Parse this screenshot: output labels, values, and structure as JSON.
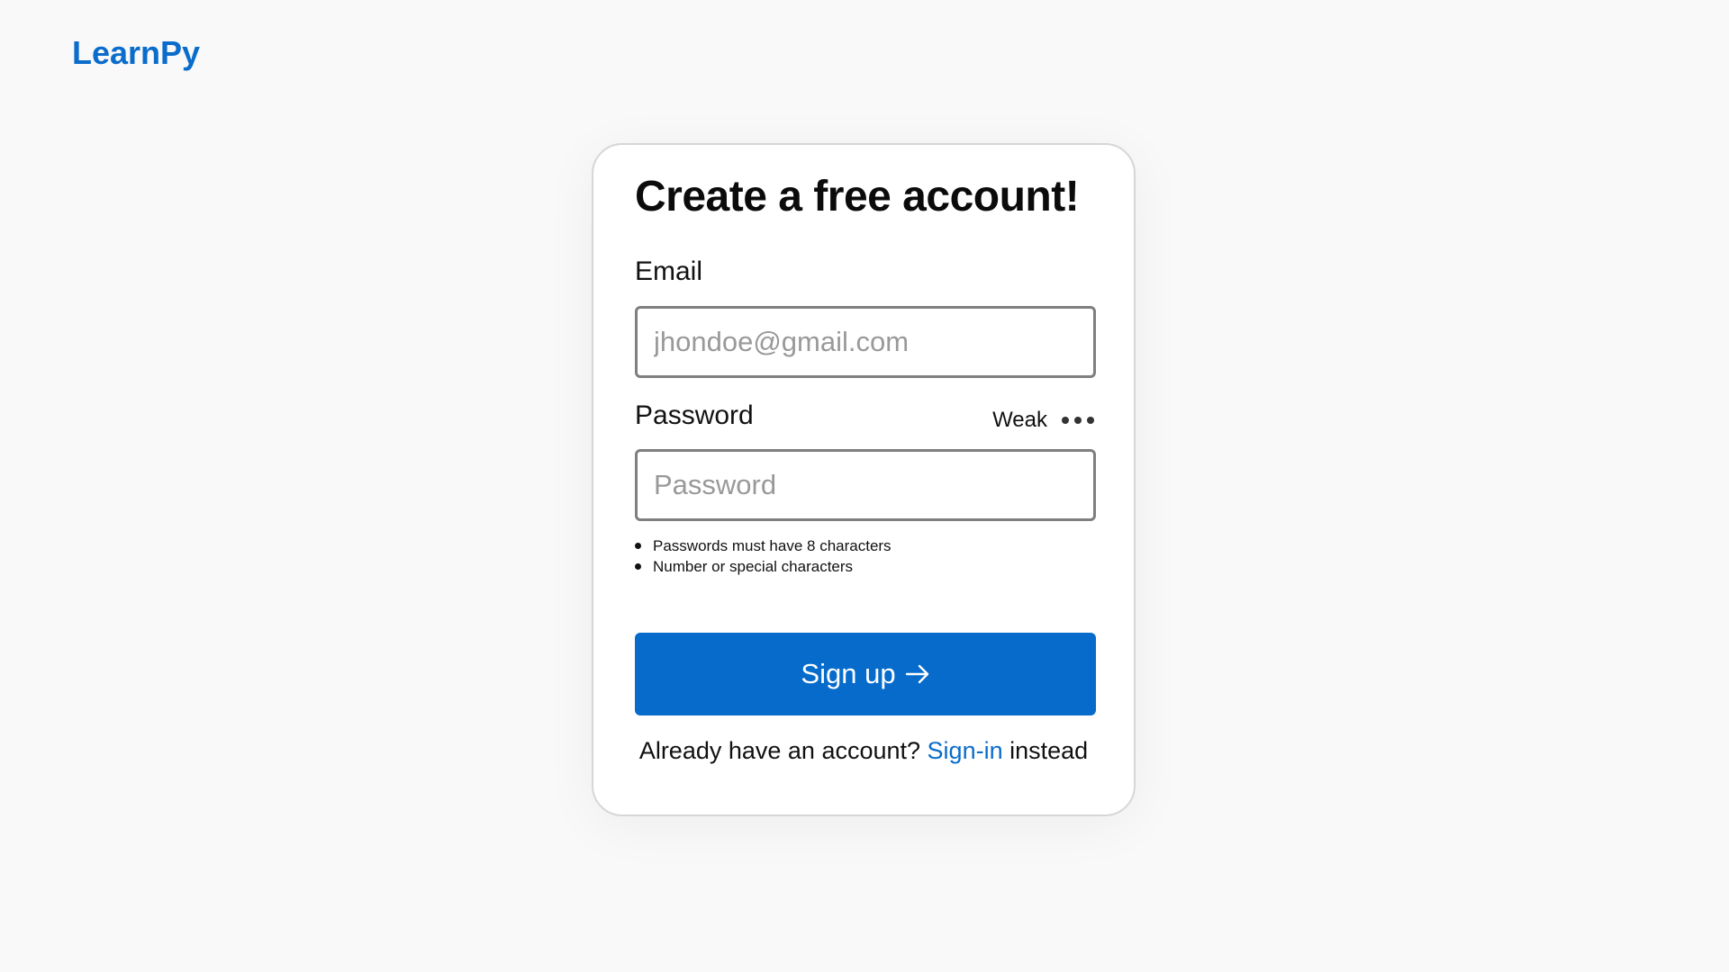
{
  "brand": {
    "name": "LearnPy",
    "color": "#0a6ccb"
  },
  "form": {
    "title": "Create a free account!",
    "email": {
      "label": "Email",
      "placeholder": "jhondoe@gmail.com",
      "value": ""
    },
    "password": {
      "label": "Password",
      "placeholder": "Password",
      "value": "",
      "strength_label": "Weak",
      "rules": [
        "Passwords must have 8 characters",
        "Number or special characters"
      ]
    },
    "submit": {
      "label": "Sign up",
      "icon": "arrow-right-icon",
      "color": "#066bcb"
    },
    "signin": {
      "prefix": "Already have an account?",
      "link_label": "Sign-in",
      "suffix": "instead"
    }
  }
}
